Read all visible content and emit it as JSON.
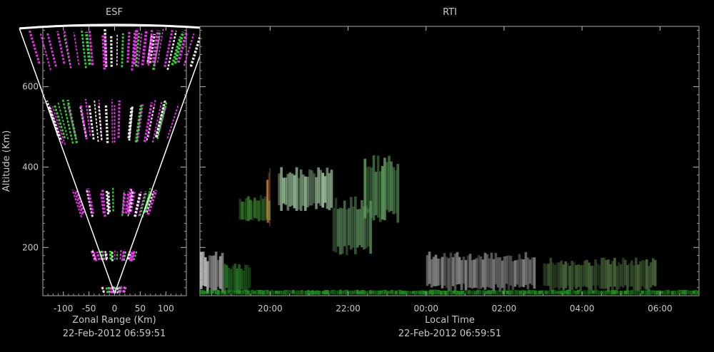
{
  "chart_data": [
    {
      "type": "heatmap",
      "panel": "esf",
      "title": "ESF",
      "xlabel": "Zonal Range (Km)",
      "ylabel": "Altitude (Km)",
      "timestamp": "22-Feb-2012 06:59:51",
      "xlim": [
        -140,
        140
      ],
      "ylim": [
        80,
        750
      ],
      "x_ticks": [
        -100,
        -50,
        0,
        50,
        100
      ],
      "x_tick_labels": [
        "-100",
        "-50",
        "0",
        "50",
        "100"
      ],
      "y_ticks": [
        200,
        400,
        600
      ],
      "y_tick_labels": [
        "200",
        "400",
        "600"
      ],
      "beam_half_angle_deg": 14,
      "echo_layers_km": [
        [
          85,
          105
        ],
        [
          165,
          195
        ],
        [
          275,
          350
        ],
        [
          455,
          570
        ],
        [
          640,
          745
        ]
      ],
      "colors": {
        "strong": "#ff33ff",
        "medium": "#33ee33",
        "core": "#ffffff"
      }
    },
    {
      "type": "heatmap",
      "panel": "rti",
      "title": "RTI",
      "xlabel": "Local Time",
      "ylabel": "",
      "timestamp": "22-Feb-2012 06:59:51",
      "xlim_hours": [
        18.2,
        31.0
      ],
      "ylim": [
        80,
        750
      ],
      "x_ticks_hours": [
        20,
        22,
        24,
        26,
        28,
        30
      ],
      "x_tick_labels": [
        "20:00",
        "22:00",
        "00:00",
        "02:00",
        "04:00",
        "06:00"
      ],
      "y_ticks": [
        200,
        400,
        600
      ],
      "echo_regions": [
        {
          "t": [
            18.2,
            18.8
          ],
          "alt": [
            85,
            190
          ],
          "color": "#c8c8c8"
        },
        {
          "t": [
            18.8,
            19.5
          ],
          "alt": [
            85,
            160
          ],
          "color": "#2a7a2a"
        },
        {
          "t": [
            19.2,
            20.0
          ],
          "alt": [
            260,
            330
          ],
          "color": "#3c8a30"
        },
        {
          "t": [
            19.9,
            20.0
          ],
          "alt": [
            250,
            400
          ],
          "color": "#c8783c"
        },
        {
          "t": [
            20.2,
            21.6
          ],
          "alt": [
            290,
            400
          ],
          "color": "#a0c8a0"
        },
        {
          "t": [
            21.6,
            22.6
          ],
          "alt": [
            180,
            330
          ],
          "color": "#5a8a5a"
        },
        {
          "t": [
            22.4,
            23.3
          ],
          "alt": [
            260,
            430
          ],
          "color": "#60a060"
        },
        {
          "t": [
            24.0,
            26.8
          ],
          "alt": [
            90,
            190
          ],
          "color": "#8a8a8a"
        },
        {
          "t": [
            27.0,
            29.9
          ],
          "alt": [
            90,
            175
          ],
          "color": "#4a6a3c"
        },
        {
          "t": [
            18.2,
            31.0
          ],
          "alt": [
            82,
            95
          ],
          "color": "#1fa01f"
        }
      ]
    }
  ]
}
